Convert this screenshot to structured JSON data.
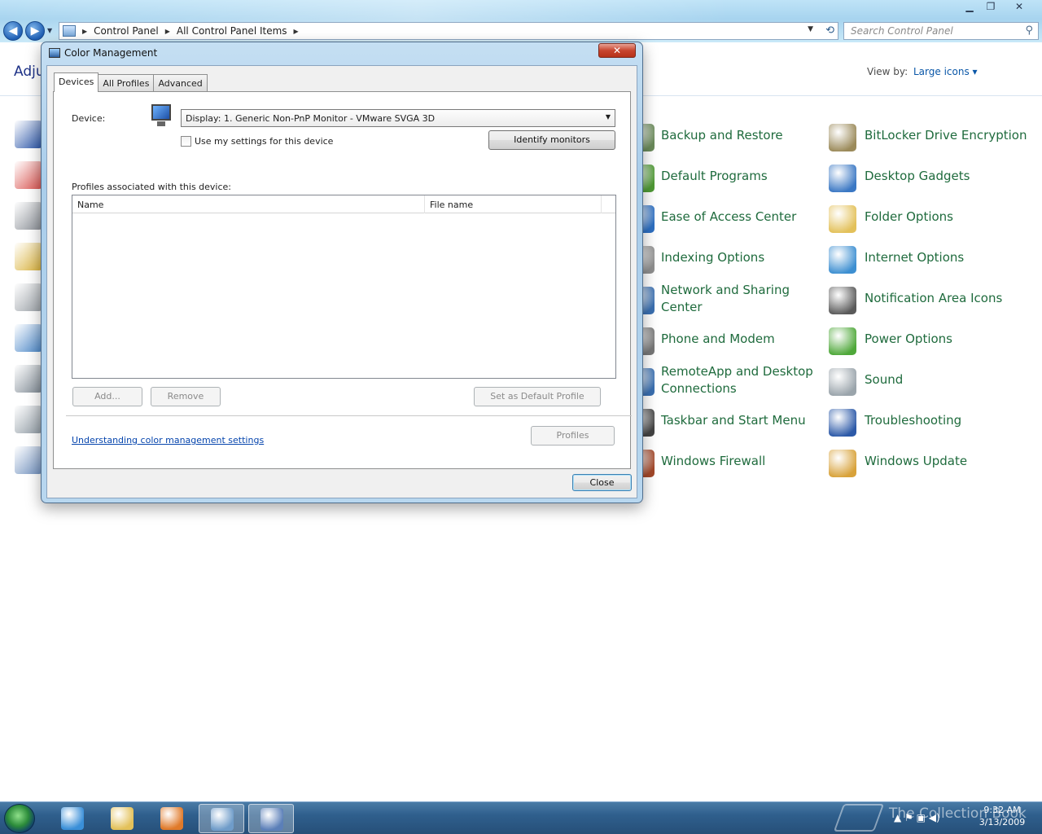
{
  "window": {
    "controls": {
      "minimize": "▁",
      "maximize": "❐",
      "close": "✕"
    }
  },
  "address_bar": {
    "crumbs": [
      "Control Panel",
      "All Control Panel Items"
    ],
    "search_placeholder": "Search Control Panel"
  },
  "control_panel": {
    "heading_partial": "Adju",
    "view_by_label": "View by:",
    "view_by_value": "Large icons ▾",
    "left_icons": [
      "action-center-flag-icon",
      "color-management-icon",
      "device-manager-icon",
      "fonts-icon",
      "keyboard-icon",
      "parental-controls-icon",
      "recovery-icon",
      "speech-recognition-icon",
      "user-accounts-icon"
    ],
    "column2": [
      {
        "label": "Backup and Restore",
        "icon": "backup-icon",
        "color": "#6a8a5a"
      },
      {
        "label": "Default Programs",
        "icon": "default-programs-icon",
        "color": "#4f9a35"
      },
      {
        "label": "Ease of Access Center",
        "icon": "ease-of-access-icon",
        "color": "#2d6fc2"
      },
      {
        "label": "Indexing Options",
        "icon": "indexing-icon",
        "color": "#8f8f8f"
      },
      {
        "label": "Network and Sharing\nCenter",
        "icon": "network-icon",
        "color": "#3a6fb0"
      },
      {
        "label": "Phone and Modem",
        "icon": "phone-modem-icon",
        "color": "#777777"
      },
      {
        "label": "RemoteApp and Desktop\nConnections",
        "icon": "remoteapp-icon",
        "color": "#3a6fb0"
      },
      {
        "label": "Taskbar and Start Menu",
        "icon": "taskbar-icon",
        "color": "#444444"
      },
      {
        "label": "Windows Firewall",
        "icon": "firewall-icon",
        "color": "#a3482a"
      }
    ],
    "column3": [
      {
        "label": "BitLocker Drive Encryption",
        "icon": "bitlocker-icon",
        "color": "#9b8a5a"
      },
      {
        "label": "Desktop Gadgets",
        "icon": "gadgets-icon",
        "color": "#3b78c4"
      },
      {
        "label": "Folder Options",
        "icon": "folder-options-icon",
        "color": "#e3c15a"
      },
      {
        "label": "Internet Options",
        "icon": "internet-options-icon",
        "color": "#3d8fd1"
      },
      {
        "label": "Notification Area Icons",
        "icon": "notification-area-icon",
        "color": "#5a5a5a"
      },
      {
        "label": "Power Options",
        "icon": "power-options-icon",
        "color": "#4fa83a"
      },
      {
        "label": "Sound",
        "icon": "sound-icon",
        "color": "#9aa4ab"
      },
      {
        "label": "Troubleshooting",
        "icon": "troubleshooting-icon",
        "color": "#2d5aa8"
      },
      {
        "label": "Windows Update",
        "icon": "windows-update-icon",
        "color": "#d8a23a"
      }
    ]
  },
  "dialog": {
    "title": "Color Management",
    "tabs": [
      "Devices",
      "All Profiles",
      "Advanced"
    ],
    "device_label": "Device:",
    "device_value": "Display: 1. Generic Non-PnP Monitor - VMware SVGA 3D",
    "use_settings_label": "Use my settings for this device",
    "identify_label": "Identify monitors",
    "profiles_label": "Profiles associated with this device:",
    "columns": [
      "Name",
      "File name"
    ],
    "add_label": "Add...",
    "remove_label": "Remove",
    "set_default_label": "Set as Default Profile",
    "link_label": "Understanding color management settings",
    "profiles_btn_label": "Profiles",
    "close_label": "Close"
  },
  "taskbar": {
    "pinned": [
      "internet-explorer-icon",
      "windows-explorer-icon",
      "media-player-icon",
      "control-panel-icon",
      "color-management-icon"
    ],
    "watermark": "The Collection Book",
    "time": "9:32 AM",
    "date": "3/13/2009",
    "tray_icons": "▲ ⚑ ▣ ◀)"
  }
}
